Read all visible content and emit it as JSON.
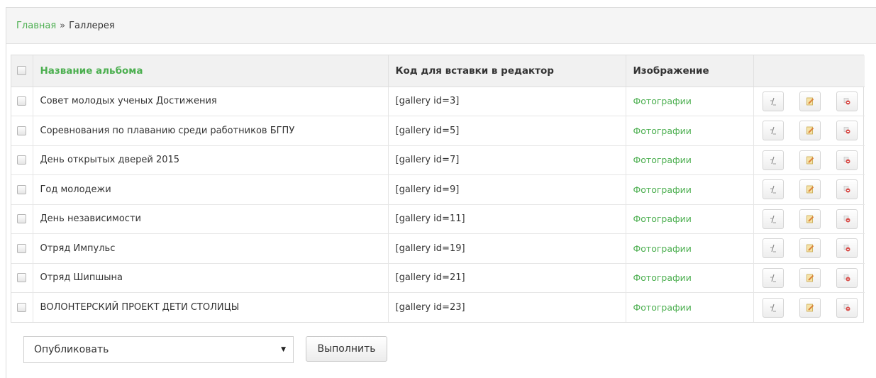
{
  "breadcrumb": {
    "home": "Главная",
    "separator": "»",
    "current": "Галлерея"
  },
  "table": {
    "headers": {
      "album": "Название альбома",
      "code": "Код для вставки в редактор",
      "image": "Изображение"
    },
    "rows": [
      {
        "name": "Совет молодых ученых Достижения",
        "code": "[gallery id=3]",
        "image": "Фотографии"
      },
      {
        "name": "Соревнования по плаванию среди работников БГПУ",
        "code": "[gallery id=5]",
        "image": "Фотографии"
      },
      {
        "name": "День открытых дверей 2015",
        "code": "[gallery id=7]",
        "image": "Фотографии"
      },
      {
        "name": "Год молодежи",
        "code": "[gallery id=9]",
        "image": "Фотографии"
      },
      {
        "name": "День независимости",
        "code": "[gallery id=11]",
        "image": "Фотографии"
      },
      {
        "name": "Отряд Импульс",
        "code": "[gallery id=19]",
        "image": "Фотографии"
      },
      {
        "name": "Отряд Шипшына",
        "code": "[gallery id=21]",
        "image": "Фотографии"
      },
      {
        "name": "ВОЛОНТЕРСКИЙ ПРОЕКТ ДЕТИ СТОЛИЦЫ",
        "code": "[gallery id=23]",
        "image": "Фотографии"
      }
    ],
    "row_actions": [
      "sort-icon",
      "edit-icon",
      "delete-icon"
    ]
  },
  "bulk": {
    "selected_action": "Опубликовать",
    "execute_label": "Выполнить"
  },
  "colors": {
    "accent_green": "#4caf50",
    "header_bg": "#f1f1f1",
    "breadcrumb_bg": "#f5f5f5"
  }
}
